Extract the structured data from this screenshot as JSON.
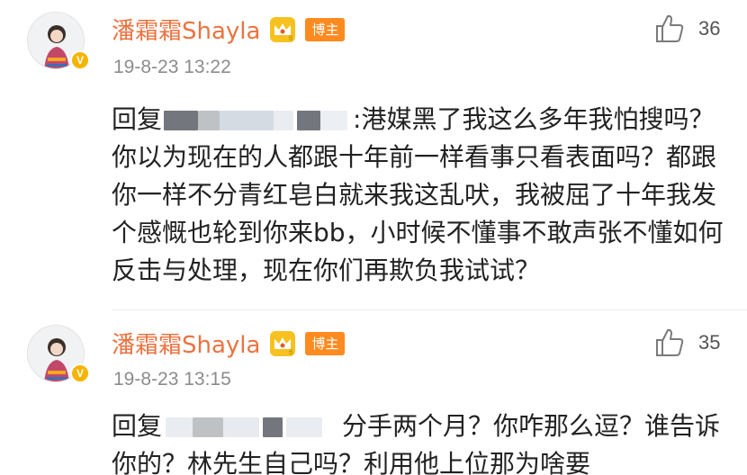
{
  "comments": [
    {
      "username": "潘霜霜Shayla",
      "badge": "博主",
      "timestamp": "19-8-23 13:22",
      "likes": "36",
      "reply_prefix": "回复",
      "text": ":港媒黑了我这么多年我怕搜吗？你以为现在的人都跟十年前一样看事只看表面吗？都跟你一样不分青红皂白就来我这乱吠，我被屈了十年我发个感慨也轮到你来bb，小时候不懂事不敢声张不懂如何反击与处理，现在你们再欺负我试试？"
    },
    {
      "username": "潘霜霜Shayla",
      "badge": "博主",
      "timestamp": "19-8-23 13:15",
      "likes": "35",
      "reply_prefix": "回复",
      "text": "分手两个月？你咋那么逗？谁告诉你的？林先生自己吗？利用他上位那为啥要"
    }
  ],
  "icons": {
    "like": "thumbs-up-icon",
    "crown": "crown-icon",
    "verified": "verified-v-icon"
  },
  "colors": {
    "username": "#eb7340",
    "badge_bg": "#ff8a1f",
    "verified": "#f5b400"
  }
}
